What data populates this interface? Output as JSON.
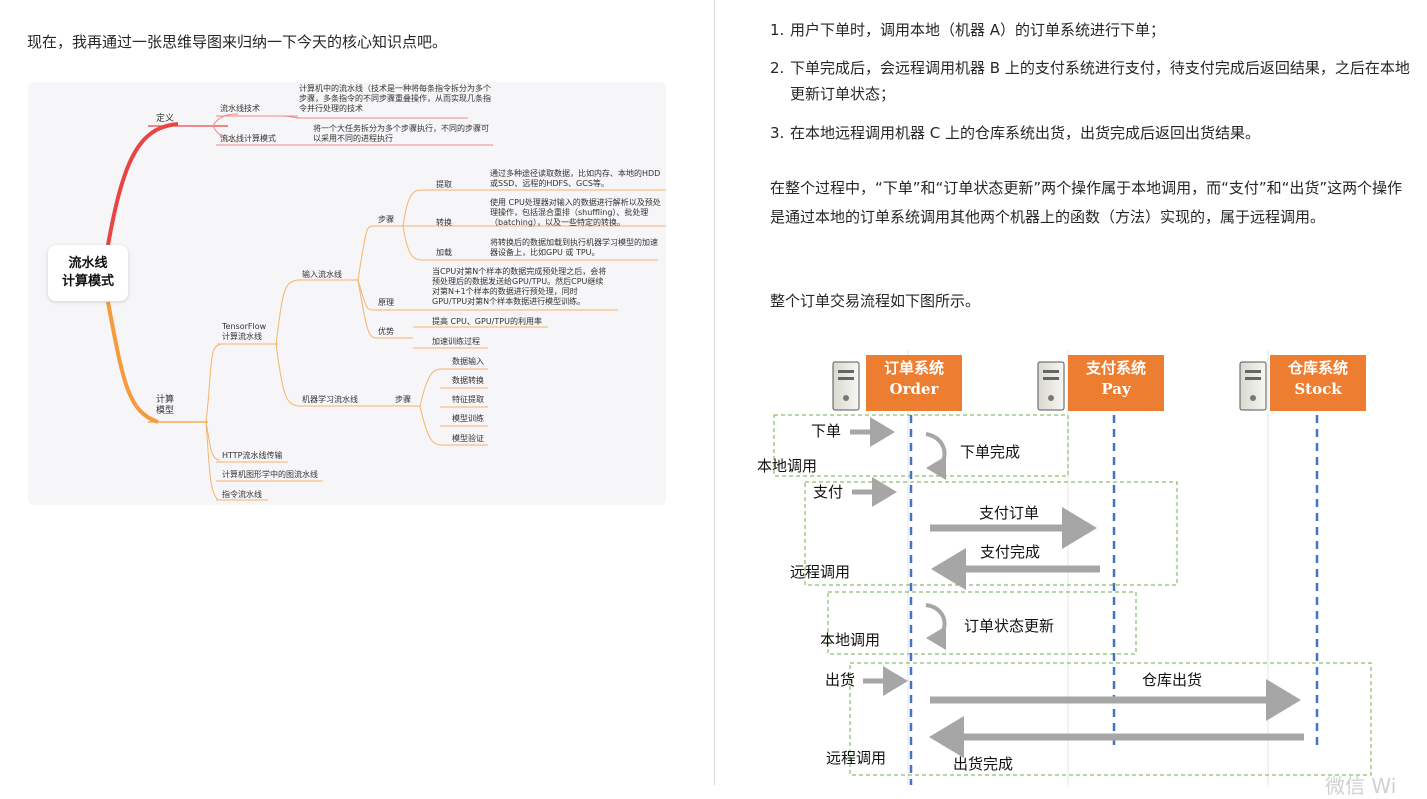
{
  "left": {
    "intro": "现在，我再通过一张思维导图来归纳一下今天的核心知识点吧。",
    "mindmap": {
      "root": [
        "流水线",
        "计算模式"
      ],
      "definition": {
        "label": "定义",
        "tech": "流水线技术",
        "tech_desc": "计算机中的流水线（技术是一种将每条指令拆分为多个步骤，多条指令的不同步骤重叠操作，从而实现几条指令并行处理的技术",
        "mode": "流水线计算模式",
        "mode_desc": "将一个大任务拆分为多个步骤执行，不同的步骤可以采用不同的进程执行"
      },
      "compute": {
        "label": [
          "计算",
          "模型"
        ],
        "tensorflow": [
          "TensorFlow",
          "计算流水线"
        ],
        "input": "输入流水线",
        "steps": "步骤",
        "extract": "提取",
        "extract_desc": "通过多种途径读取数据，比如内存、本地的HDD或SSD、远程的HDFS、GCS等。",
        "transform": "转换",
        "transform_desc": "使用 CPU处理器对输入的数据进行解析以及预处理操作，包括混合重排（shuffling）、批处理（batching），以及一些特定的转换。",
        "load": "加载",
        "load_desc": "将转换后的数据加载到执行机器学习模型的加速器设备上，比如GPU 或 TPU。",
        "principle": "原理",
        "principle_desc": "当CPU对第N个样本的数据完成预处理之后，会将预处理后的数据发送给GPU/TPU。然后CPU继续对第N+1个样本的数据进行预处理，同时GPU/TPU对第N个样本数据进行模型训练。",
        "advantage": "优势",
        "adv1": "提高 CPU、GPU/TPU的利用率",
        "adv2": "加速训练过程",
        "ml": "机器学习流水线",
        "ml_steps": "步骤",
        "ml_items": [
          "数据输入",
          "数据转换",
          "特征提取",
          "模型训练",
          "模型验证"
        ],
        "http": "HTTP流水线传输",
        "graphics": "计算机图形学中的图流水线",
        "instruction": "指令流水线"
      }
    }
  },
  "right": {
    "list": [
      {
        "num": "1.",
        "text": "用户下单时，调用本地（机器 A）的订单系统进行下单；"
      },
      {
        "num": "2.",
        "text": "下单完成后，会远程调用机器 B 上的支付系统进行支付，待支付完成后返回结果，之后在本地更新订单状态；"
      },
      {
        "num": "3.",
        "text": "在本地远程调用机器 C 上的仓库系统出货，出货完成后返回出货结果。"
      }
    ],
    "para1": "在整个过程中，“下单”和“订单状态更新”两个操作属于本地调用，而“支付”和“出货”这两个操作是通过本地的订单系统调用其他两个机器上的函数（方法）实现的，属于远程调用。",
    "para2": "整个订单交易流程如下图所示。",
    "diagram": {
      "systems": [
        {
          "cn": "订单系统",
          "en": "Order"
        },
        {
          "cn": "支付系统",
          "en": "Pay"
        },
        {
          "cn": "仓库系统",
          "en": "Stock"
        }
      ],
      "labels": {
        "order": "下单",
        "order_done": "下单完成",
        "local1": "本地调用",
        "pay": "支付",
        "pay_order": "支付订单",
        "pay_done": "支付完成",
        "remote1": "远程调用",
        "update": "订单状态更新",
        "local2": "本地调用",
        "ship": "出货",
        "warehouse_ship": "仓库出货",
        "remote2": "远程调用",
        "ship_done": "出货完成"
      },
      "colors": {
        "system_box": "#ed7d31",
        "lifeline": "#4472c4",
        "arrow": "#a6a6a6",
        "group_border": "#70ad47"
      }
    },
    "watermark": "微信 Wi"
  }
}
